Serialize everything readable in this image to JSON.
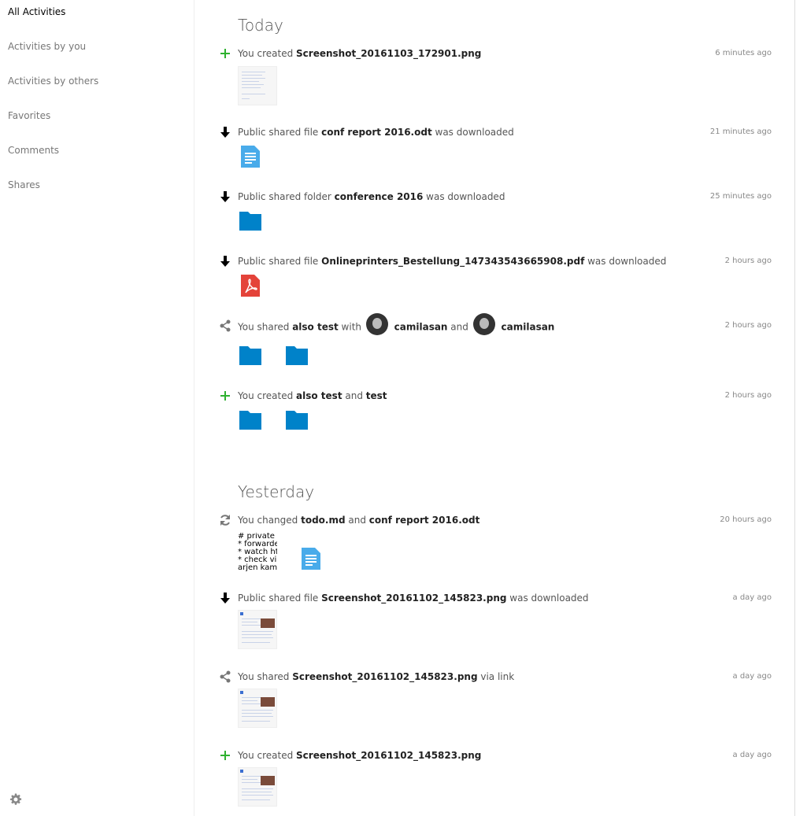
{
  "sidebar": {
    "items": [
      {
        "label": "All Activities"
      },
      {
        "label": "Activities by you"
      },
      {
        "label": "Activities by others"
      },
      {
        "label": "Favorites"
      },
      {
        "label": "Comments"
      },
      {
        "label": "Shares"
      }
    ],
    "settings_icon": "gear-icon"
  },
  "sections": {
    "today": "Today",
    "yesterday": "Yesterday"
  },
  "activities": [
    {
      "icon": "plus-icon",
      "time": "6 minutes ago",
      "t0": "You created ",
      "b0": "Screenshot_20161103_172901.png"
    },
    {
      "icon": "download-icon",
      "time": "21 minutes ago",
      "t0": "Public shared file ",
      "b0": "conf report 2016.odt",
      "t1": " was downloaded"
    },
    {
      "icon": "download-icon",
      "time": "25 minutes ago",
      "t0": "Public shared folder ",
      "b0": "conference 2016",
      "t1": " was downloaded"
    },
    {
      "icon": "download-icon",
      "time": "2 hours ago",
      "t0": "Public shared file ",
      "b0": "Onlineprinters_Bestellung_147343543665908.pdf",
      "t1": " was downloaded"
    },
    {
      "icon": "share-icon",
      "time": "2 hours ago",
      "t0": "You shared ",
      "b0": "also test",
      "t1": " with ",
      "u0": "camilasan",
      "t2": " and ",
      "u1": "camilasan"
    },
    {
      "icon": "plus-icon",
      "time": "2 hours ago",
      "t0": "You created ",
      "b0": "also test",
      "t1": " and ",
      "b1": "test"
    },
    {
      "icon": "sync-icon",
      "time": "20 hours ago",
      "t0": "You changed ",
      "b0": "todo.md",
      "t1": " and ",
      "b1": "conf report 2016.odt"
    },
    {
      "icon": "download-icon",
      "time": "a day ago",
      "t0": "Public shared file ",
      "b0": "Screenshot_20161102_145823.png",
      "t1": " was downloaded"
    },
    {
      "icon": "share-icon",
      "time": "a day ago",
      "t0": "You shared ",
      "b0": "Screenshot_20161102_145823.png",
      "t1": " via link"
    },
    {
      "icon": "plus-icon",
      "time": "a day ago",
      "t0": "You created ",
      "b0": "Screenshot_20161102_145823.png"
    }
  ],
  "todo_preview": [
    "# private",
    "* forwarde",
    "* watch ht",
    "* check vic",
    "arjen kamp"
  ],
  "colors": {
    "plus": "#2fb130",
    "folder": "#0082c9",
    "doc": "#49abea",
    "pdf": "#e4433a"
  }
}
